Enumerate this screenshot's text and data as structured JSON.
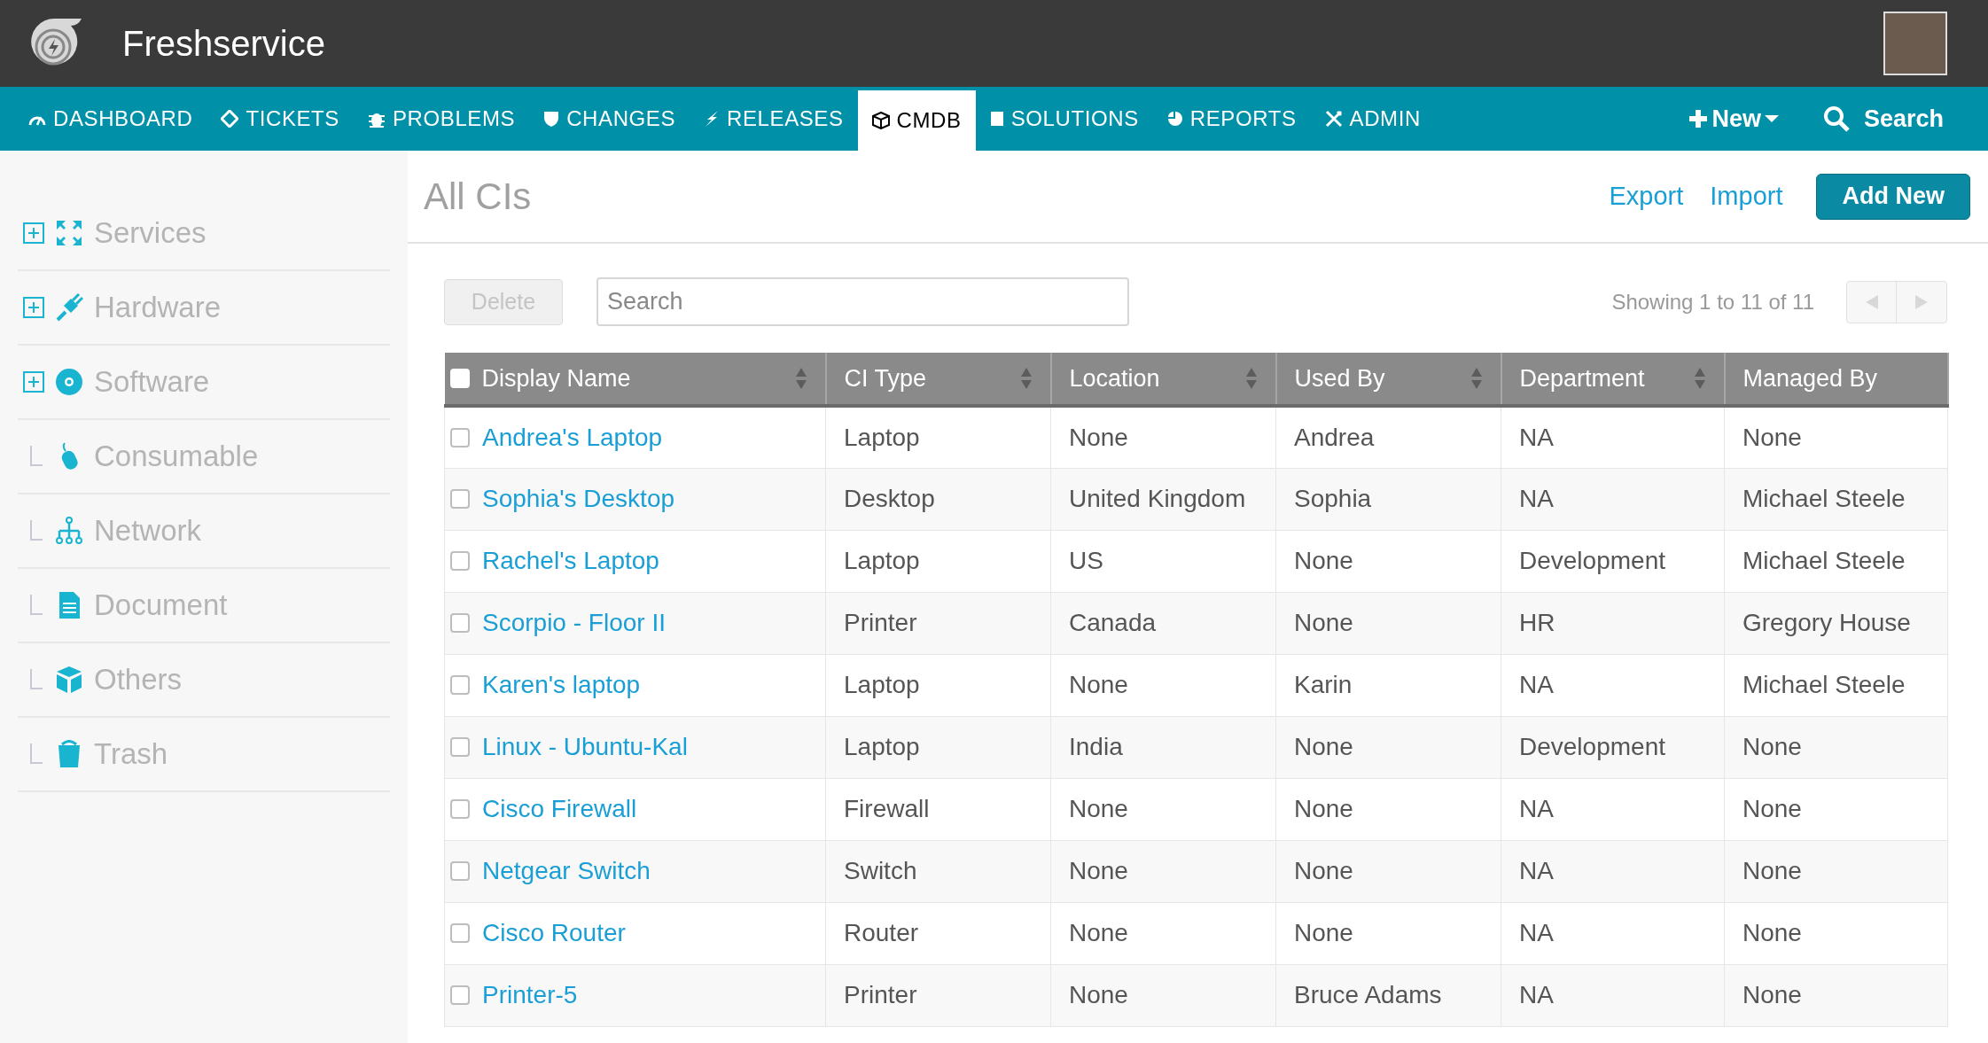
{
  "app": {
    "name": "Freshservice"
  },
  "nav": {
    "tabs": [
      {
        "label": "DASHBOARD",
        "selected": false
      },
      {
        "label": "TICKETS",
        "selected": false
      },
      {
        "label": "PROBLEMS",
        "selected": false
      },
      {
        "label": "CHANGES",
        "selected": false
      },
      {
        "label": "RELEASES",
        "selected": false
      },
      {
        "label": "CMDB",
        "selected": true
      },
      {
        "label": "SOLUTIONS",
        "selected": false
      },
      {
        "label": "REPORTS",
        "selected": false
      },
      {
        "label": "ADMIN",
        "selected": false
      }
    ],
    "new_button": "New",
    "search_button": "Search"
  },
  "sidebar": {
    "items": [
      {
        "label": "Services",
        "kind": "expandable"
      },
      {
        "label": "Hardware",
        "kind": "expandable"
      },
      {
        "label": "Software",
        "kind": "expandable"
      },
      {
        "label": "Consumable",
        "kind": "child"
      },
      {
        "label": "Network",
        "kind": "child"
      },
      {
        "label": "Document",
        "kind": "child"
      },
      {
        "label": "Others",
        "kind": "child"
      },
      {
        "label": "Trash",
        "kind": "child"
      }
    ]
  },
  "page": {
    "title": "All CIs",
    "links": [
      "Export",
      "Import"
    ],
    "add_button": "Add New"
  },
  "toolbar": {
    "delete_button": "Delete",
    "search": {
      "placeholder": "Search"
    },
    "paging": "Showing 1 to 11 of 11"
  },
  "table": {
    "select_all_checked": false,
    "columns": [
      "Display Name",
      "CI Type",
      "Location",
      "Used By",
      "Department",
      "Managed By"
    ],
    "rows": [
      {
        "checked": false,
        "cells": [
          "Andrea's Laptop",
          "Laptop",
          "None",
          "Andrea",
          "NA",
          "None"
        ]
      },
      {
        "checked": false,
        "cells": [
          "Sophia's Desktop",
          "Desktop",
          "United Kingdom",
          "Sophia",
          "NA",
          "Michael Steele"
        ]
      },
      {
        "checked": false,
        "cells": [
          "Rachel's Laptop",
          "Laptop",
          "US",
          "None",
          "Development",
          "Michael Steele"
        ]
      },
      {
        "checked": false,
        "cells": [
          "Scorpio - Floor II",
          "Printer",
          "Canada",
          "None",
          "HR",
          "Gregory House"
        ]
      },
      {
        "checked": false,
        "cells": [
          "Karen's laptop",
          "Laptop",
          "None",
          "Karin",
          "NA",
          "Michael Steele"
        ]
      },
      {
        "checked": false,
        "cells": [
          "Linux - Ubuntu-Kal",
          "Laptop",
          "India",
          "None",
          "Development",
          "None"
        ]
      },
      {
        "checked": false,
        "cells": [
          "Cisco Firewall",
          "Firewall",
          "None",
          "None",
          "NA",
          "None"
        ]
      },
      {
        "checked": false,
        "cells": [
          "Netgear Switch",
          "Switch",
          "None",
          "None",
          "NA",
          "None"
        ]
      },
      {
        "checked": false,
        "cells": [
          "Cisco Router",
          "Router",
          "None",
          "None",
          "NA",
          "None"
        ]
      },
      {
        "checked": false,
        "cells": [
          "Printer-5",
          "Printer",
          "None",
          "Bruce Adams",
          "NA",
          "None"
        ]
      }
    ]
  }
}
